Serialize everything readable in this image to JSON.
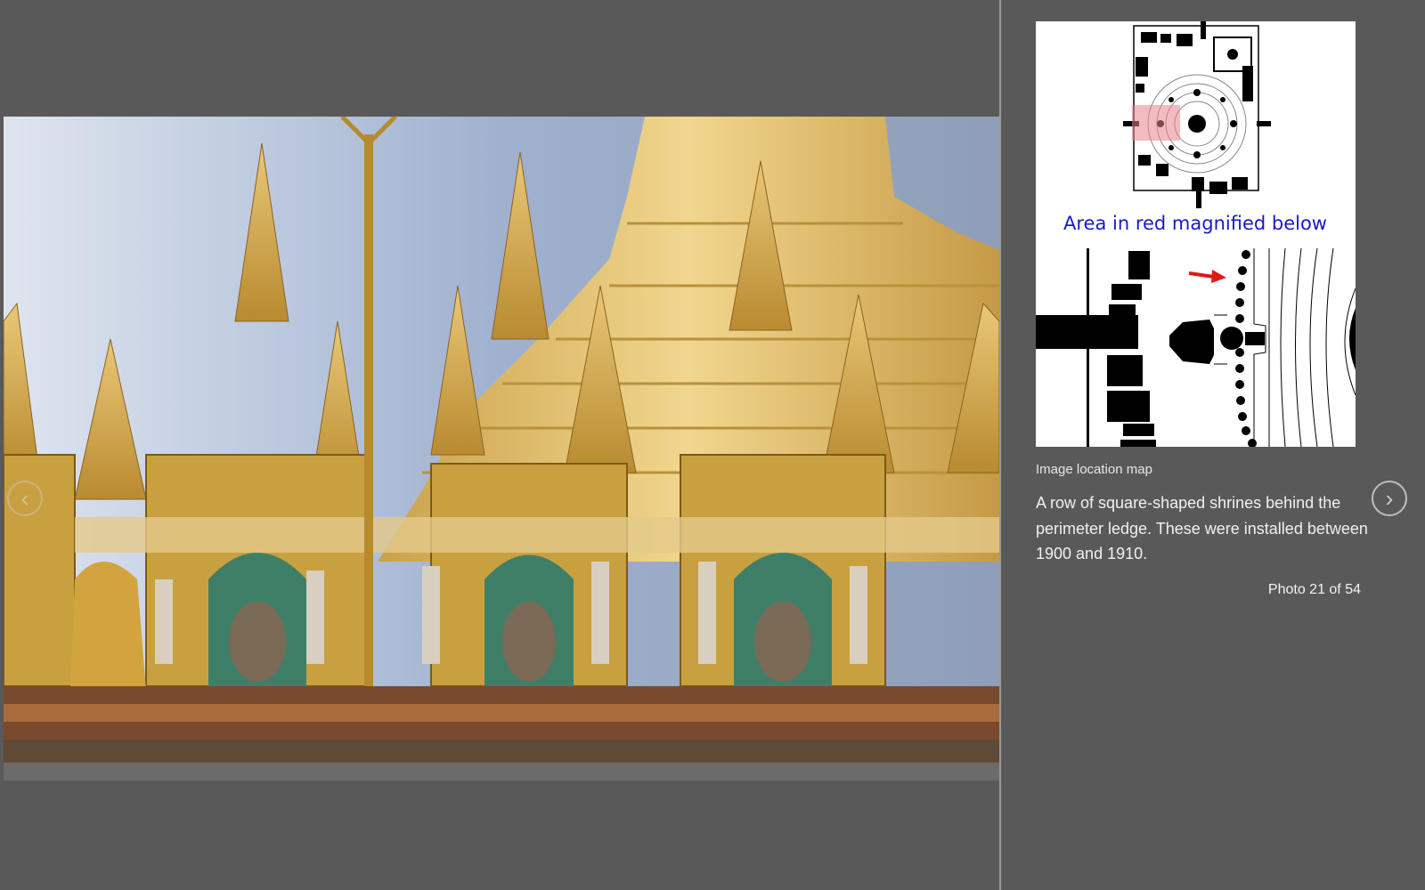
{
  "viewer": {
    "photo_alt": "Shwedagon shrines photo",
    "prev_icon": "chevron-left-icon",
    "next_icon": "chevron-right-icon"
  },
  "sidebar": {
    "map_heading": "Area in red magnified below",
    "map_label": "Image location map",
    "caption": "A row of square-shaped shrines behind the perimeter ledge. These were installed between 1900 and 1910.",
    "counter": "Photo 21 of 54"
  },
  "colors": {
    "background": "#595959",
    "highlight": "#f2b3b8",
    "arrow": "#e01818",
    "map_heading": "#1a1ac8"
  }
}
